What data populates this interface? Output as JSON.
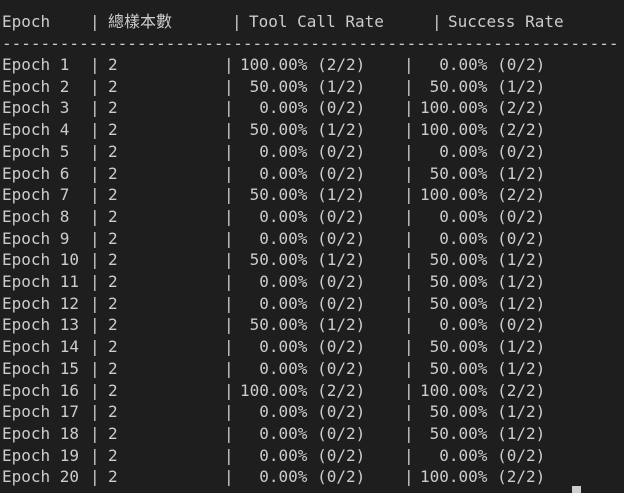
{
  "header": {
    "epoch": "Epoch",
    "samples": "總樣本數",
    "tool_call_rate": "Tool Call Rate",
    "success_rate": "Success Rate",
    "pipe": "|"
  },
  "separator": "----------------------------------------------------------------------------",
  "rows": [
    {
      "epoch": "Epoch 1",
      "samples": "2",
      "tool": "100.00% (2/2)",
      "success": "  0.00% (0/2)"
    },
    {
      "epoch": "Epoch 2",
      "samples": "2",
      "tool": " 50.00% (1/2)",
      "success": " 50.00% (1/2)"
    },
    {
      "epoch": "Epoch 3",
      "samples": "2",
      "tool": "  0.00% (0/2)",
      "success": "100.00% (2/2)"
    },
    {
      "epoch": "Epoch 4",
      "samples": "2",
      "tool": " 50.00% (1/2)",
      "success": "100.00% (2/2)"
    },
    {
      "epoch": "Epoch 5",
      "samples": "2",
      "tool": "  0.00% (0/2)",
      "success": "  0.00% (0/2)"
    },
    {
      "epoch": "Epoch 6",
      "samples": "2",
      "tool": "  0.00% (0/2)",
      "success": " 50.00% (1/2)"
    },
    {
      "epoch": "Epoch 7",
      "samples": "2",
      "tool": " 50.00% (1/2)",
      "success": "100.00% (2/2)"
    },
    {
      "epoch": "Epoch 8",
      "samples": "2",
      "tool": "  0.00% (0/2)",
      "success": "  0.00% (0/2)"
    },
    {
      "epoch": "Epoch 9",
      "samples": "2",
      "tool": "  0.00% (0/2)",
      "success": "  0.00% (0/2)"
    },
    {
      "epoch": "Epoch 10",
      "samples": "2",
      "tool": " 50.00% (1/2)",
      "success": " 50.00% (1/2)"
    },
    {
      "epoch": "Epoch 11",
      "samples": "2",
      "tool": "  0.00% (0/2)",
      "success": " 50.00% (1/2)"
    },
    {
      "epoch": "Epoch 12",
      "samples": "2",
      "tool": "  0.00% (0/2)",
      "success": " 50.00% (1/2)"
    },
    {
      "epoch": "Epoch 13",
      "samples": "2",
      "tool": " 50.00% (1/2)",
      "success": "  0.00% (0/2)"
    },
    {
      "epoch": "Epoch 14",
      "samples": "2",
      "tool": "  0.00% (0/2)",
      "success": " 50.00% (1/2)"
    },
    {
      "epoch": "Epoch 15",
      "samples": "2",
      "tool": "  0.00% (0/2)",
      "success": " 50.00% (1/2)"
    },
    {
      "epoch": "Epoch 16",
      "samples": "2",
      "tool": "100.00% (2/2)",
      "success": "100.00% (2/2)"
    },
    {
      "epoch": "Epoch 17",
      "samples": "2",
      "tool": "  0.00% (0/2)",
      "success": " 50.00% (1/2)"
    },
    {
      "epoch": "Epoch 18",
      "samples": "2",
      "tool": "  0.00% (0/2)",
      "success": " 50.00% (1/2)"
    },
    {
      "epoch": "Epoch 19",
      "samples": "2",
      "tool": "  0.00% (0/2)",
      "success": "  0.00% (0/2)"
    },
    {
      "epoch": "Epoch 20",
      "samples": "2",
      "tool": "  0.00% (0/2)",
      "success": "100.00% (2/2)"
    }
  ]
}
